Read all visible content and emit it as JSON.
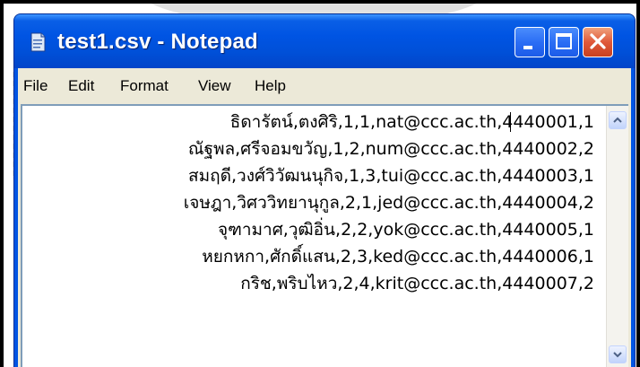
{
  "window": {
    "title": "test1.csv - Notepad"
  },
  "menu": {
    "items": [
      "File",
      "Edit",
      "Format",
      "View",
      "Help"
    ]
  },
  "document": {
    "lines": [
      "ธิดารัตน์,ตงศิริ,1,1,nat@ccc.ac.th,4440001,1",
      "ณัฐพล,ศรีจอมขวัญ,1,2,num@ccc.ac.th,4440002,2",
      "สมฤดี,วงศ์วิวัฒนนุกิจ,1,3,tui@ccc.ac.th,4440003,1",
      "เจษฎา,วิศววิทยานุกูล,2,1,jed@ccc.ac.th,4440004,2",
      "จุฑามาศ,วุฒิอิ่น,2,2,yok@ccc.ac.th,4440005,1",
      "หยกหกา,ศักดิ์แสน,2,3,ked@ccc.ac.th,4440006,1",
      "กริช,พริบไหว,2,4,krit@ccc.ac.th,4440007,2"
    ]
  },
  "colors": {
    "titlebar": "#0054e3",
    "close_button": "#e0593a",
    "chrome": "#ece9d8"
  },
  "icons": {
    "app": "notepad-icon",
    "minimize": "minimize-icon",
    "maximize": "maximize-icon",
    "close": "close-icon",
    "scroll_up": "arrow-up-icon",
    "scroll_down": "arrow-down-icon"
  }
}
